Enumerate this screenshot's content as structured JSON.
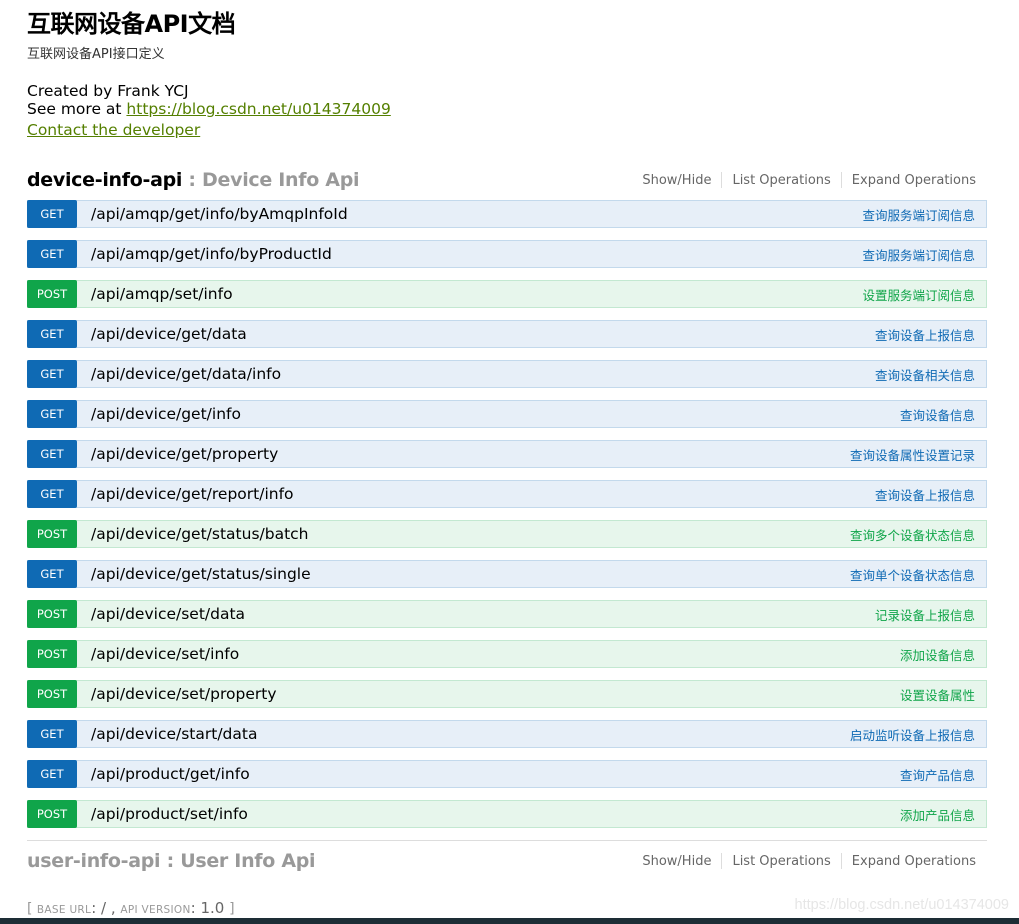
{
  "info": {
    "title": "互联网设备API文档",
    "description": "互联网设备API接口定义",
    "created_by": "Created by Frank YCJ",
    "see_more_prefix": "See more at ",
    "see_more_link": "https://blog.csdn.net/u014374009",
    "contact_label": "Contact the developer"
  },
  "resources": [
    {
      "name": "device-info-api",
      "separator": " : ",
      "description": "Device Info Api",
      "ops": {
        "show_hide": "Show/Hide",
        "list_operations": "List Operations",
        "expand_operations": "Expand Operations"
      },
      "endpoints": [
        {
          "method": "GET",
          "path": "/api/amqp/get/info/byAmqpInfoId",
          "summary": "查询服务端订阅信息"
        },
        {
          "method": "GET",
          "path": "/api/amqp/get/info/byProductId",
          "summary": "查询服务端订阅信息"
        },
        {
          "method": "POST",
          "path": "/api/amqp/set/info",
          "summary": "设置服务端订阅信息"
        },
        {
          "method": "GET",
          "path": "/api/device/get/data",
          "summary": "查询设备上报信息"
        },
        {
          "method": "GET",
          "path": "/api/device/get/data/info",
          "summary": "查询设备相关信息"
        },
        {
          "method": "GET",
          "path": "/api/device/get/info",
          "summary": "查询设备信息"
        },
        {
          "method": "GET",
          "path": "/api/device/get/property",
          "summary": "查询设备属性设置记录"
        },
        {
          "method": "GET",
          "path": "/api/device/get/report/info",
          "summary": "查询设备上报信息"
        },
        {
          "method": "POST",
          "path": "/api/device/get/status/batch",
          "summary": "查询多个设备状态信息"
        },
        {
          "method": "GET",
          "path": "/api/device/get/status/single",
          "summary": "查询单个设备状态信息"
        },
        {
          "method": "POST",
          "path": "/api/device/set/data",
          "summary": "记录设备上报信息"
        },
        {
          "method": "POST",
          "path": "/api/device/set/info",
          "summary": "添加设备信息"
        },
        {
          "method": "POST",
          "path": "/api/device/set/property",
          "summary": "设置设备属性"
        },
        {
          "method": "GET",
          "path": "/api/device/start/data",
          "summary": "启动监听设备上报信息"
        },
        {
          "method": "GET",
          "path": "/api/product/get/info",
          "summary": "查询产品信息"
        },
        {
          "method": "POST",
          "path": "/api/product/set/info",
          "summary": "添加产品信息"
        }
      ]
    },
    {
      "name": "user-info-api",
      "separator": " : ",
      "description": "User Info Api",
      "ops": {
        "show_hide": "Show/Hide",
        "list_operations": "List Operations",
        "expand_operations": "Expand Operations"
      }
    }
  ],
  "footer": {
    "open_bracket": "[ ",
    "base_url_label": "base url",
    "base_url_value": ": / , ",
    "api_version_label": "api version",
    "api_version_value": ": 1.0 ",
    "close_bracket": "]"
  },
  "watermark": "https://blog.csdn.net/u014374009",
  "colors": {
    "get": "#0f6ab4",
    "post": "#10a54a",
    "link": "#547f00"
  }
}
